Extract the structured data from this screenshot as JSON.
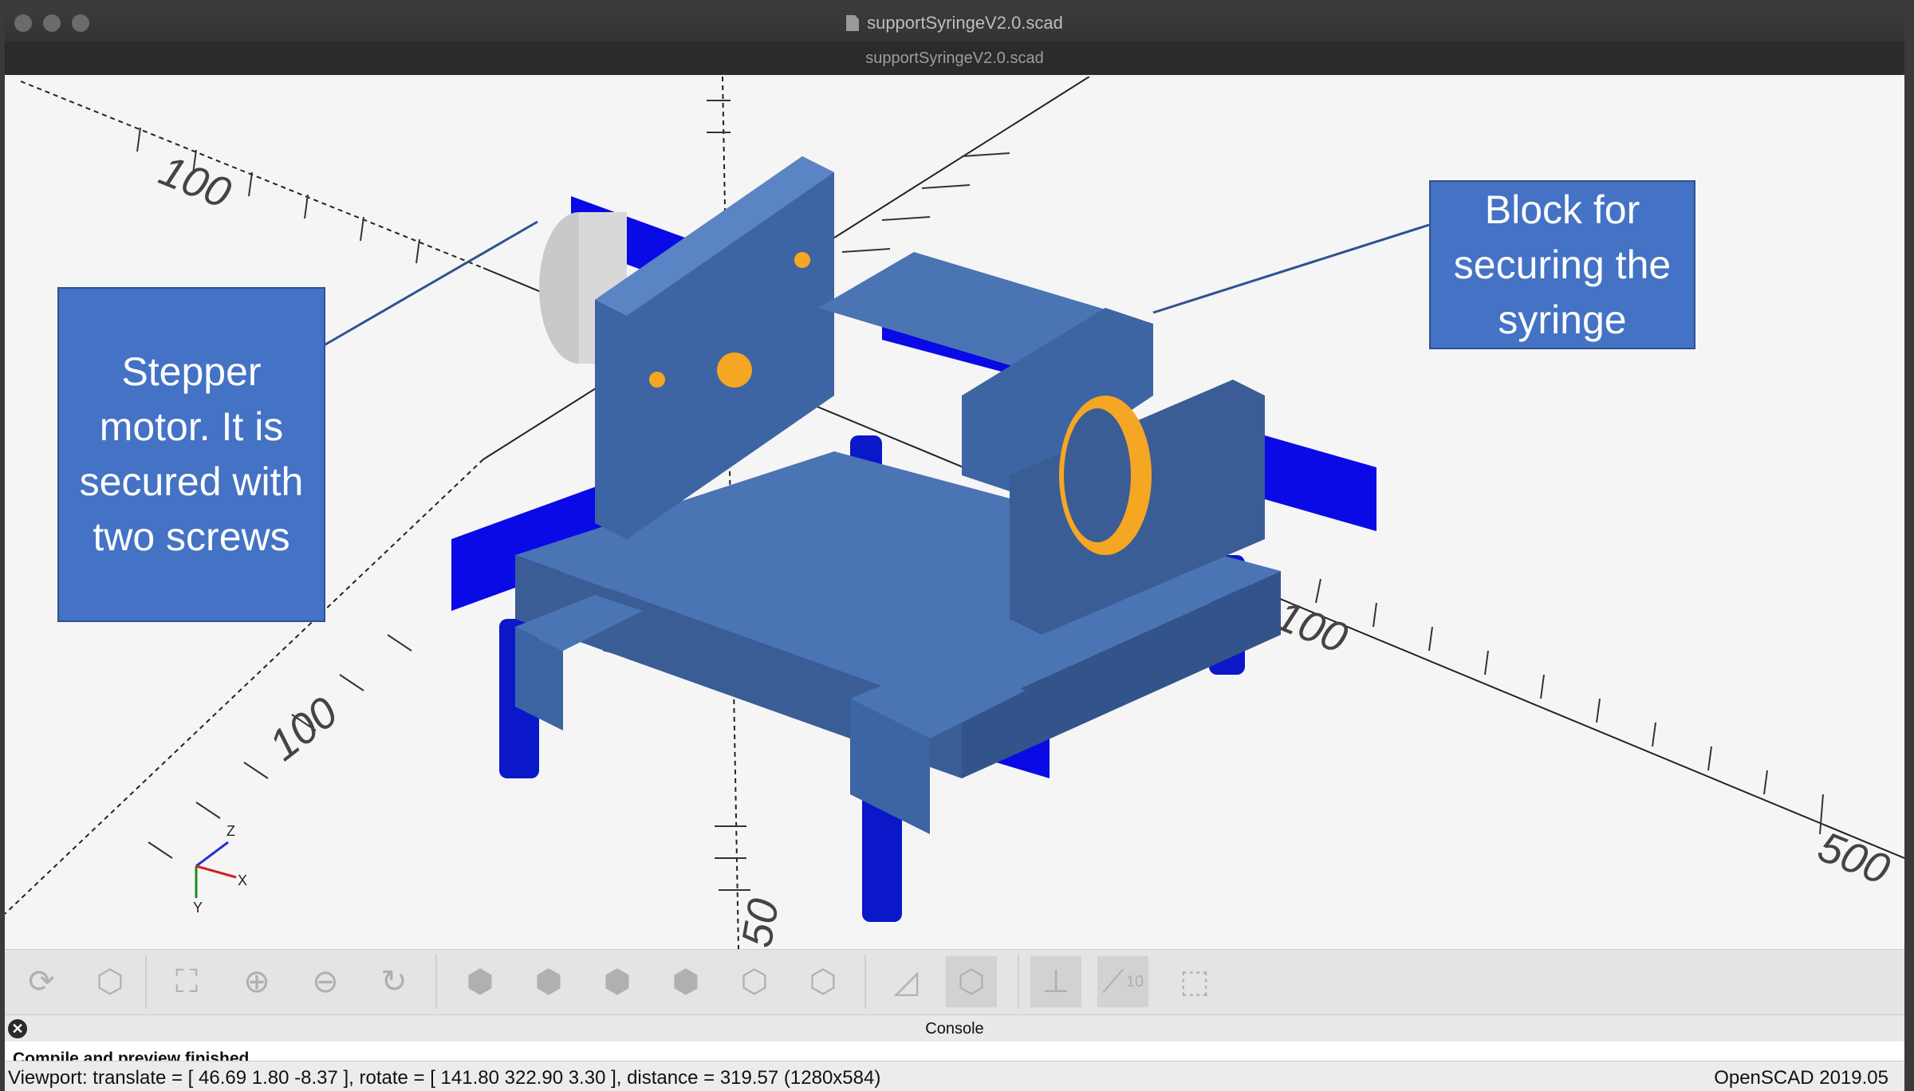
{
  "window": {
    "title": "supportSyringeV2.0.scad",
    "subtitle": "supportSyringeV2.0.scad"
  },
  "viewport": {
    "axis_labels": {
      "x_top_left": "100",
      "x_right_mid": "100",
      "x_right_far": "500",
      "y_left": "100",
      "y_bottom": "50"
    },
    "gizmo": {
      "z": "Z",
      "x": "X",
      "y": "Y"
    },
    "callouts": {
      "stepper": "Stepper motor. It is secured with two screws",
      "block": "Block for securing the syringe"
    },
    "colors": {
      "background": "#f5f5f5",
      "model_blue": "#4a74b3",
      "pure_blue": "#0a0ae6",
      "orange": "#f5a623",
      "callout": "#4472c4"
    }
  },
  "toolbar": {
    "buttons": [
      {
        "name": "preview-icon"
      },
      {
        "name": "render-icon"
      },
      {
        "name": "view-all-icon"
      },
      {
        "name": "zoom-in-icon"
      },
      {
        "name": "zoom-out-icon"
      },
      {
        "name": "reset-view-icon"
      },
      {
        "name": "view-right-icon"
      },
      {
        "name": "view-top-icon"
      },
      {
        "name": "view-bottom-icon"
      },
      {
        "name": "view-left-icon"
      },
      {
        "name": "view-front-icon"
      },
      {
        "name": "view-back-icon"
      },
      {
        "name": "perspective-icon"
      },
      {
        "name": "orthogonal-icon"
      },
      {
        "name": "show-axes-icon"
      },
      {
        "name": "show-scale-icon"
      },
      {
        "name": "show-edges-icon"
      }
    ],
    "scale_badge": "10"
  },
  "console": {
    "label": "Console",
    "close_glyph": "✕",
    "line": "Compile and preview finished"
  },
  "status": {
    "viewport": "Viewport: translate = [ 46.69 1.80 -8.37 ], rotate = [ 141.80 322.90 3.30 ], distance = 319.57 (1280x584)",
    "version": "OpenSCAD 2019.05"
  }
}
